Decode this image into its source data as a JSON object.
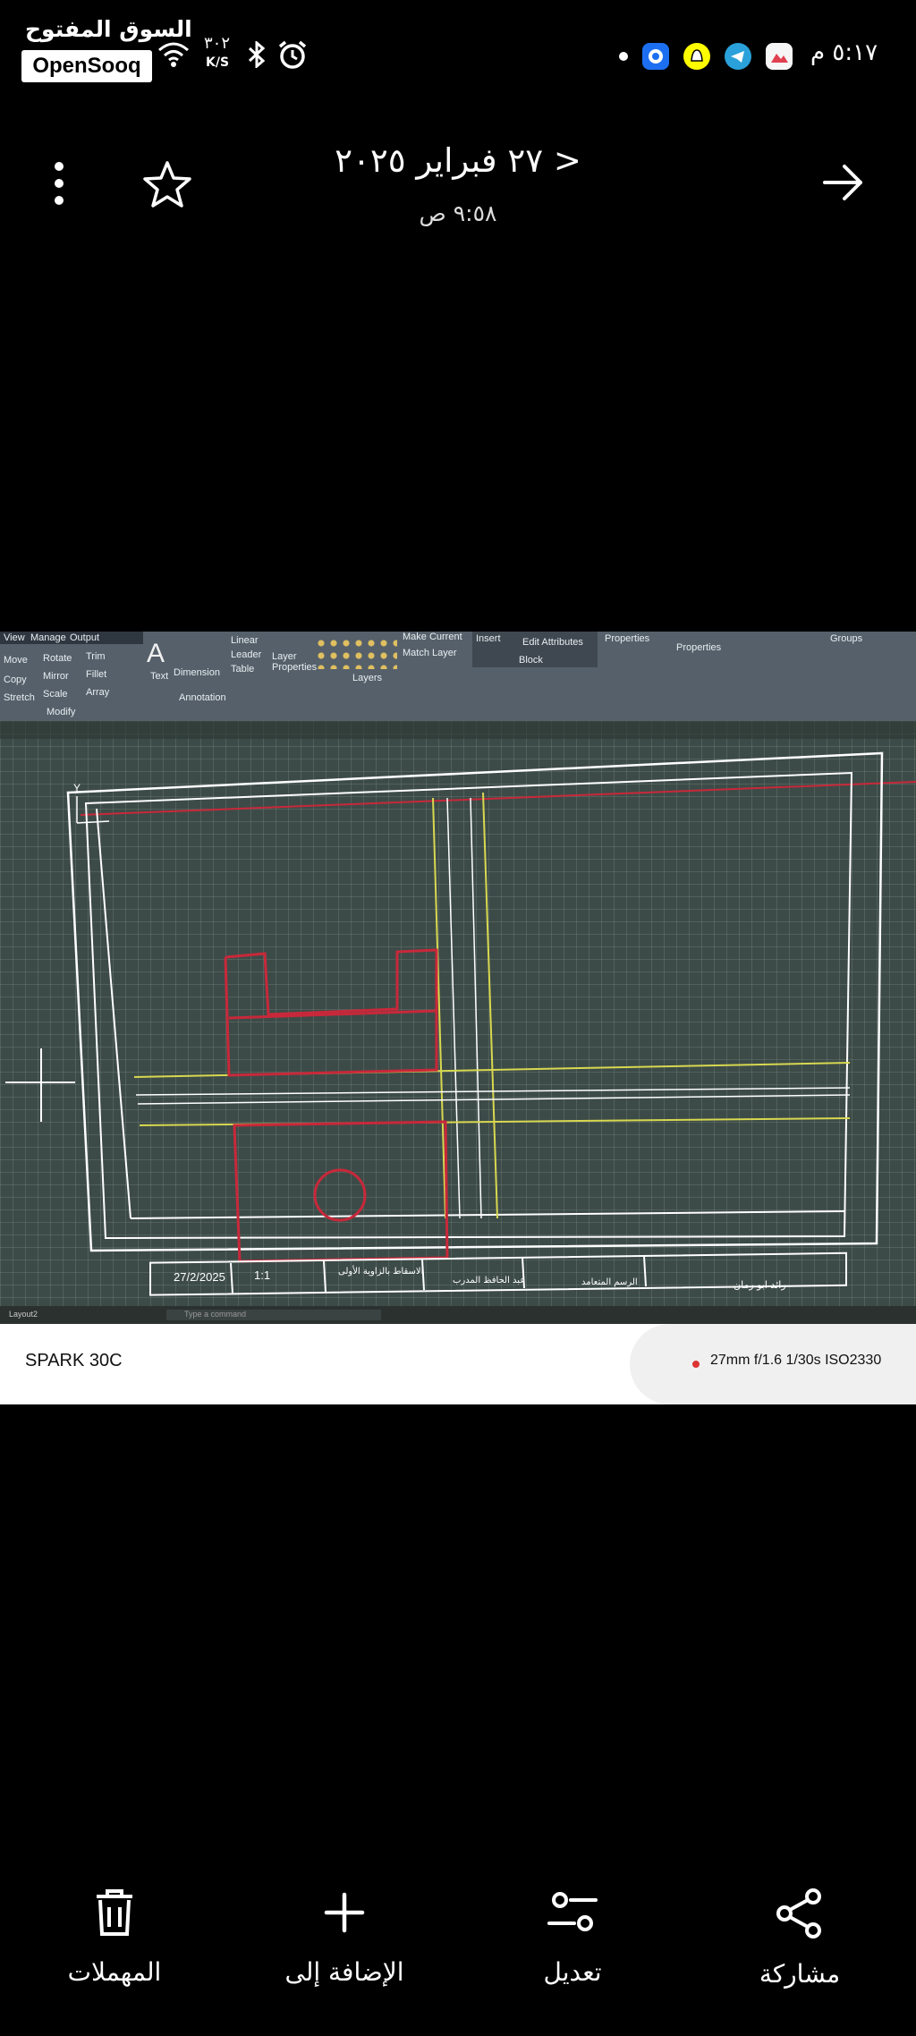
{
  "status_bar": {
    "time": "٥:١٧ م",
    "network_speed": "٣٠٢",
    "network_unit": "K/S",
    "watermark_ar": "السوق المفتوح",
    "watermark_en": "OpenSooq"
  },
  "header": {
    "date": "٢٧ فبراير ٢٠٢٥ >",
    "time": "٩:٥٨ ص",
    "icons": [
      "more-vertical-icon",
      "star-icon",
      "forward-arrow-icon"
    ]
  },
  "photo": {
    "ribbon": {
      "modify": [
        "Move",
        "Rotate",
        "Trim",
        "Copy",
        "Mirror",
        "Fillet",
        "Stretch",
        "Scale",
        "Array",
        "Modify"
      ],
      "annotation": [
        "Text",
        "Dimension",
        "Linear",
        "Leader",
        "Table",
        "Annotation"
      ],
      "layers": [
        "Layer Properties",
        "Make Current",
        "Match Layer",
        "Layers"
      ],
      "block": [
        "Insert",
        "Edit Attributes",
        "Block"
      ],
      "properties": [
        "Properties",
        "Properties"
      ],
      "groups": [
        "Groups"
      ],
      "menu": [
        "View",
        "Manage",
        "Output"
      ]
    },
    "title_block": {
      "date": "27/2/2025",
      "scale": "1:1",
      "view": "الاسقاط بالزاوية الأولى",
      "trainer": "عبد الحافظ المدرب",
      "drawing": "الرسم المتعامد",
      "student": "رائد ابو رمان"
    },
    "tab_label": "Layout2",
    "command_hint": "Type a command"
  },
  "camera_info": {
    "model": "SPARK 30C",
    "specs": "27mm f/1.6 1/30s ISO2330"
  },
  "bottom_bar": {
    "share": "مشاركة",
    "edit": "تعديل",
    "add_to": "الإضافة إلى",
    "trash": "المهملات"
  },
  "colors": {
    "background": "#000000",
    "cad_background": "#3d4b48",
    "cad_red": "#c8283a",
    "cad_yellow": "#d8d850",
    "cad_white": "#ffffff",
    "accent_dot": "#dd3333"
  }
}
